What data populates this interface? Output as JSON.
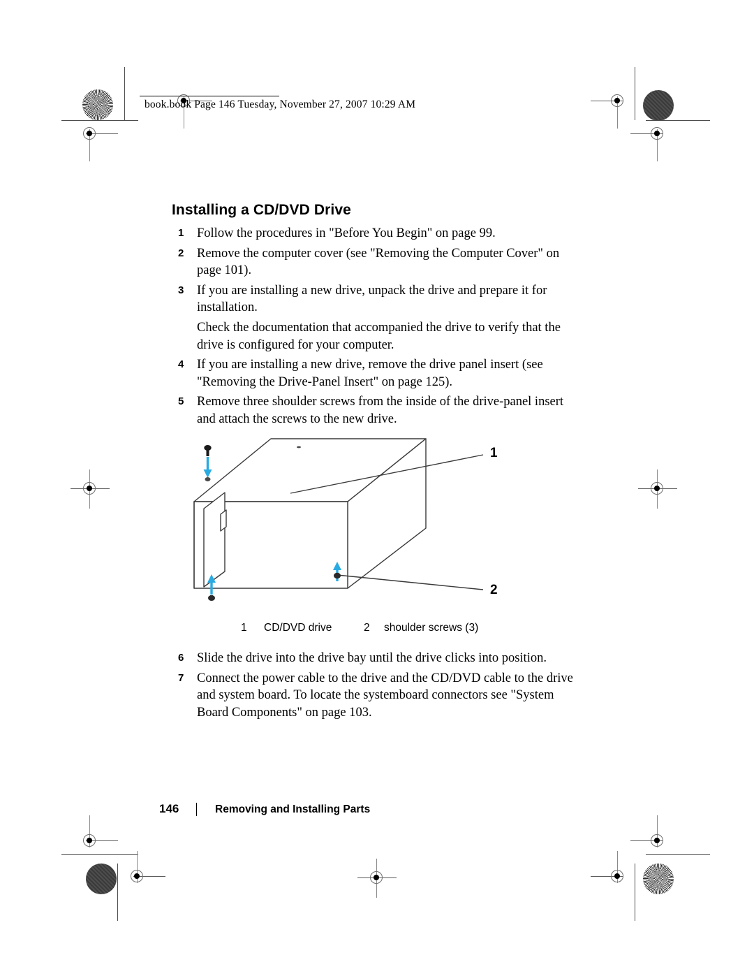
{
  "page": {
    "slug": "book.book  Page 146  Tuesday, November 27, 2007  10:29 AM",
    "section_title": "Installing a CD/DVD Drive"
  },
  "steps_upper": [
    {
      "num": "1",
      "text": "Follow the procedures in \"Before You Begin\" on page 99."
    },
    {
      "num": "2",
      "text": "Remove the computer cover (see \"Removing the Computer Cover\" on page 101)."
    },
    {
      "num": "3",
      "text": "If you are installing a new drive, unpack the drive and prepare it for installation.",
      "continuation": "Check the documentation that accompanied the drive to verify that the drive is configured for your computer."
    },
    {
      "num": "4",
      "text": "If you are installing a new drive, remove the drive panel insert (see \"Removing the Drive-Panel Insert\" on page 125)."
    },
    {
      "num": "5",
      "text": "Remove three shoulder screws from the inside of the drive-panel insert and attach the screws to the new drive."
    }
  ],
  "figure": {
    "callouts": [
      {
        "number": "1"
      },
      {
        "number": "2"
      }
    ],
    "legend": [
      {
        "number": "1",
        "label": "CD/DVD drive"
      },
      {
        "number": "2",
        "label": "shoulder screws (3)"
      }
    ],
    "colors": {
      "arrow": "#29ABE2",
      "line": "#3a3a3a"
    }
  },
  "steps_lower": [
    {
      "num": "6",
      "text": "Slide the drive into the drive bay until the drive clicks into position."
    },
    {
      "num": "7",
      "text": "Connect the power cable to the drive and the CD/DVD cable to the drive and system board. To locate the systemboard connectors see \"System Board Components\" on page 103."
    }
  ],
  "footer": {
    "page_number": "146",
    "chapter": "Removing and Installing Parts"
  }
}
